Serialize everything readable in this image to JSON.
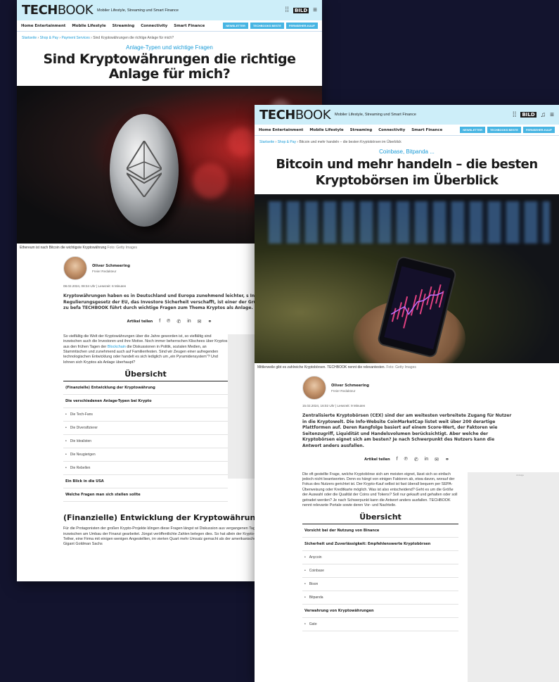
{
  "window1": {
    "logo_tech": "TECH",
    "logo_book": "BOOK",
    "tagline": "Mobiler Lifestyle, Streaming und Smart Finance",
    "bild_badge": "BILD",
    "nav": [
      "Home Entertainment",
      "Mobile Lifestyle",
      "Streaming",
      "Connectivity",
      "Smart Finance"
    ],
    "nav_buttons": [
      "NEWSLETTER",
      "TECHBOOKS BESTE",
      "FERNSEHER-KAUF"
    ],
    "breadcrumb": [
      "Startseite",
      "Shop & Pay",
      "Payment Services",
      "Sind Kryptowährungen die richtige Anlage für mich?"
    ],
    "kicker": "Anlage-Typen und wichtige Fragen",
    "headline": "Sind Kryptowährungen die richtige Anlage für mich?",
    "caption": "Ethereum ist nach Bitcoin die wichtigste Kryptowährung",
    "caption_credit": "Foto: Getty Images",
    "author_name": "Oliver Schmeering",
    "author_role": "Freier Redakteur",
    "meta": "08.02.2024, 08:34 Uhr | Lesezeit: 6 Minuten",
    "lead": "Kryptowährungen haben es in Deutschland und Europa zunehmend leichter, s Investment zu empfehlen. Das neue Regulierungsgesetz der EU, das Investore Sicherheit verschafft, ist einer der Gründe, sich mit dem Thema Krypto zu befa TECHBOOK führt durch wichtige Fragen zum Thema Kryptos als Anlage.",
    "share_label": "Artikel teilen",
    "body_1": "So vielfältig die Welt der Kryptowährungen über die Jahre geworden ist, so vielfältig sind inzwischen auch die Investoren und ihre Motive. Noch immer beherrschen Klischees über Kryptos aus den frühen Tagen der ",
    "body_link": "Blockchain",
    "body_2": " die Diskussionen in Politik, sozialen Medien, an Stammtischen und zunehmend auch auf Familienfesten. Sind wir Zeugen einer aufregenden technologischen Entwicklung oder handelt es sich lediglich um „ein Pyramidensystem“? Und lohnen sich Kryptos als Anlage überhaupt?",
    "toc_title": "Übersicht",
    "toc": [
      {
        "label": "(Finanzielle) Entwicklung der Kryptowährung",
        "sub": false
      },
      {
        "label": "Die verschiedenen Anlage-Typen bei Krypto",
        "sub": false
      },
      {
        "label": "Die Tech-Fans",
        "sub": true
      },
      {
        "label": "Die Diversifizierer",
        "sub": true
      },
      {
        "label": "Die Idealisten",
        "sub": true
      },
      {
        "label": "Die Neugierigen",
        "sub": true
      },
      {
        "label": "Die Rebellen",
        "sub": true
      },
      {
        "label": "Ein Blick in die USA",
        "sub": false
      },
      {
        "label": "Welche Fragen man sich stellen sollte",
        "sub": false
      }
    ],
    "section_heading": "(Finanzielle) Entwicklung der Kryptowährung",
    "section_text": "Für die Protagonisten der großen Krypto-Projekte klingen diese Fragen längst wi Diskussion aus vergangenen Tagen. Hier wird inzwischen am Umbau der Finanzi gearbeitet. Jüngst veröffentlichte Zahlen belegen dies. So hat allein der Krypto- Stablecoin Tether, eine Firma mit einigen wenigen Angestellten, im vierten Quart mehr Umsatz gemacht als der amerikanische Investment-Gigant Goldman Sachs"
  },
  "window2": {
    "logo_tech": "TECH",
    "logo_book": "BOOK",
    "tagline": "Mobiler Lifestyle, Streaming und Smart Finance",
    "bild_badge": "BILD",
    "nav": [
      "Home Entertainment",
      "Mobile Lifestyle",
      "Streaming",
      "Connectivity",
      "Smart Finance"
    ],
    "nav_buttons": [
      "NEWSLETTER",
      "TECHBOOKS BESTE",
      "FERNSEHER-KAUF"
    ],
    "breadcrumb": [
      "Startseite",
      "Shop & Pay",
      "Bitcoin und mehr handeln – die besten Kryptobörsen im Überblick"
    ],
    "kicker": "Coinbase, Bitpanda ...",
    "headline": "Bitcoin und mehr handeln – die besten Kryptobörsen im Überblick",
    "caption": "Mittlerweile gibt es zahlreiche Kryptobörsen. TECHBOOK nennt die relevantesten.",
    "caption_credit": "Foto: Getty Images",
    "author_name": "Oliver Schmeering",
    "author_role": "Freier Redakteur",
    "meta": "15.02.2024, 16:02 Uhr | Lesezeit: 9 Minuten",
    "lead": "Zentralisierte Kryptobörsen (CEX) sind der am weitesten verbreitete Zugang für Nutzer in die Kryptowelt. Die Info-Website CoinMarketCap listet weit über 200 derartige Plattformen auf. Deren Rangfolge basiert auf einem Score-Wert, der Faktoren wie Seitenzugriff, Liquidität und Handelsvolumen berücksichtigt. Aber welche der Kryptobörsen eignet sich am besten? Je nach Schwerpunkt des Nutzers kann die Antwort anders ausfallen.",
    "share_label": "Artikel teilen",
    "ad_label": "Anzeige",
    "body": "Die oft gestellte Frage, welche Kryptobörse sich am meisten eignet, lässt sich so einfach jedoch nicht beantworten. Denn es hängt von einigen Faktoren ab, etwa davon, worauf der Fokus des Nutzers gerichtet ist. Der Krypto-Kauf selbst ist fast überall bequem per SEPA-Überweisung oder Kreditkarte möglich. Was ist also entscheidend? Geht es um die Größe der Auswahl oder die Qualität der Coins und Tokens? Soll nur gekauft und gehalten oder soll getradet werden? Je nach Schwerpunkt kann die Antwort anders ausfallen. TECHBOOK nennt relevante Portale sowie deren Vor- und Nachteile.",
    "toc_title": "Übersicht",
    "toc": [
      {
        "label": "Vorsicht bei der Nutzung von Binance",
        "sub": false
      },
      {
        "label": "Sicherheit und Zuverlässigkeit: Empfehlenswerte Kryptobörsen",
        "sub": false
      },
      {
        "label": "Anycoin",
        "sub": true
      },
      {
        "label": "Coinbase",
        "sub": true
      },
      {
        "label": "Bison",
        "sub": true
      },
      {
        "label": "Bitpanda",
        "sub": true
      },
      {
        "label": "Verwahrung von Kryptowährungen",
        "sub": false
      },
      {
        "label": "Gate",
        "sub": true
      }
    ]
  }
}
